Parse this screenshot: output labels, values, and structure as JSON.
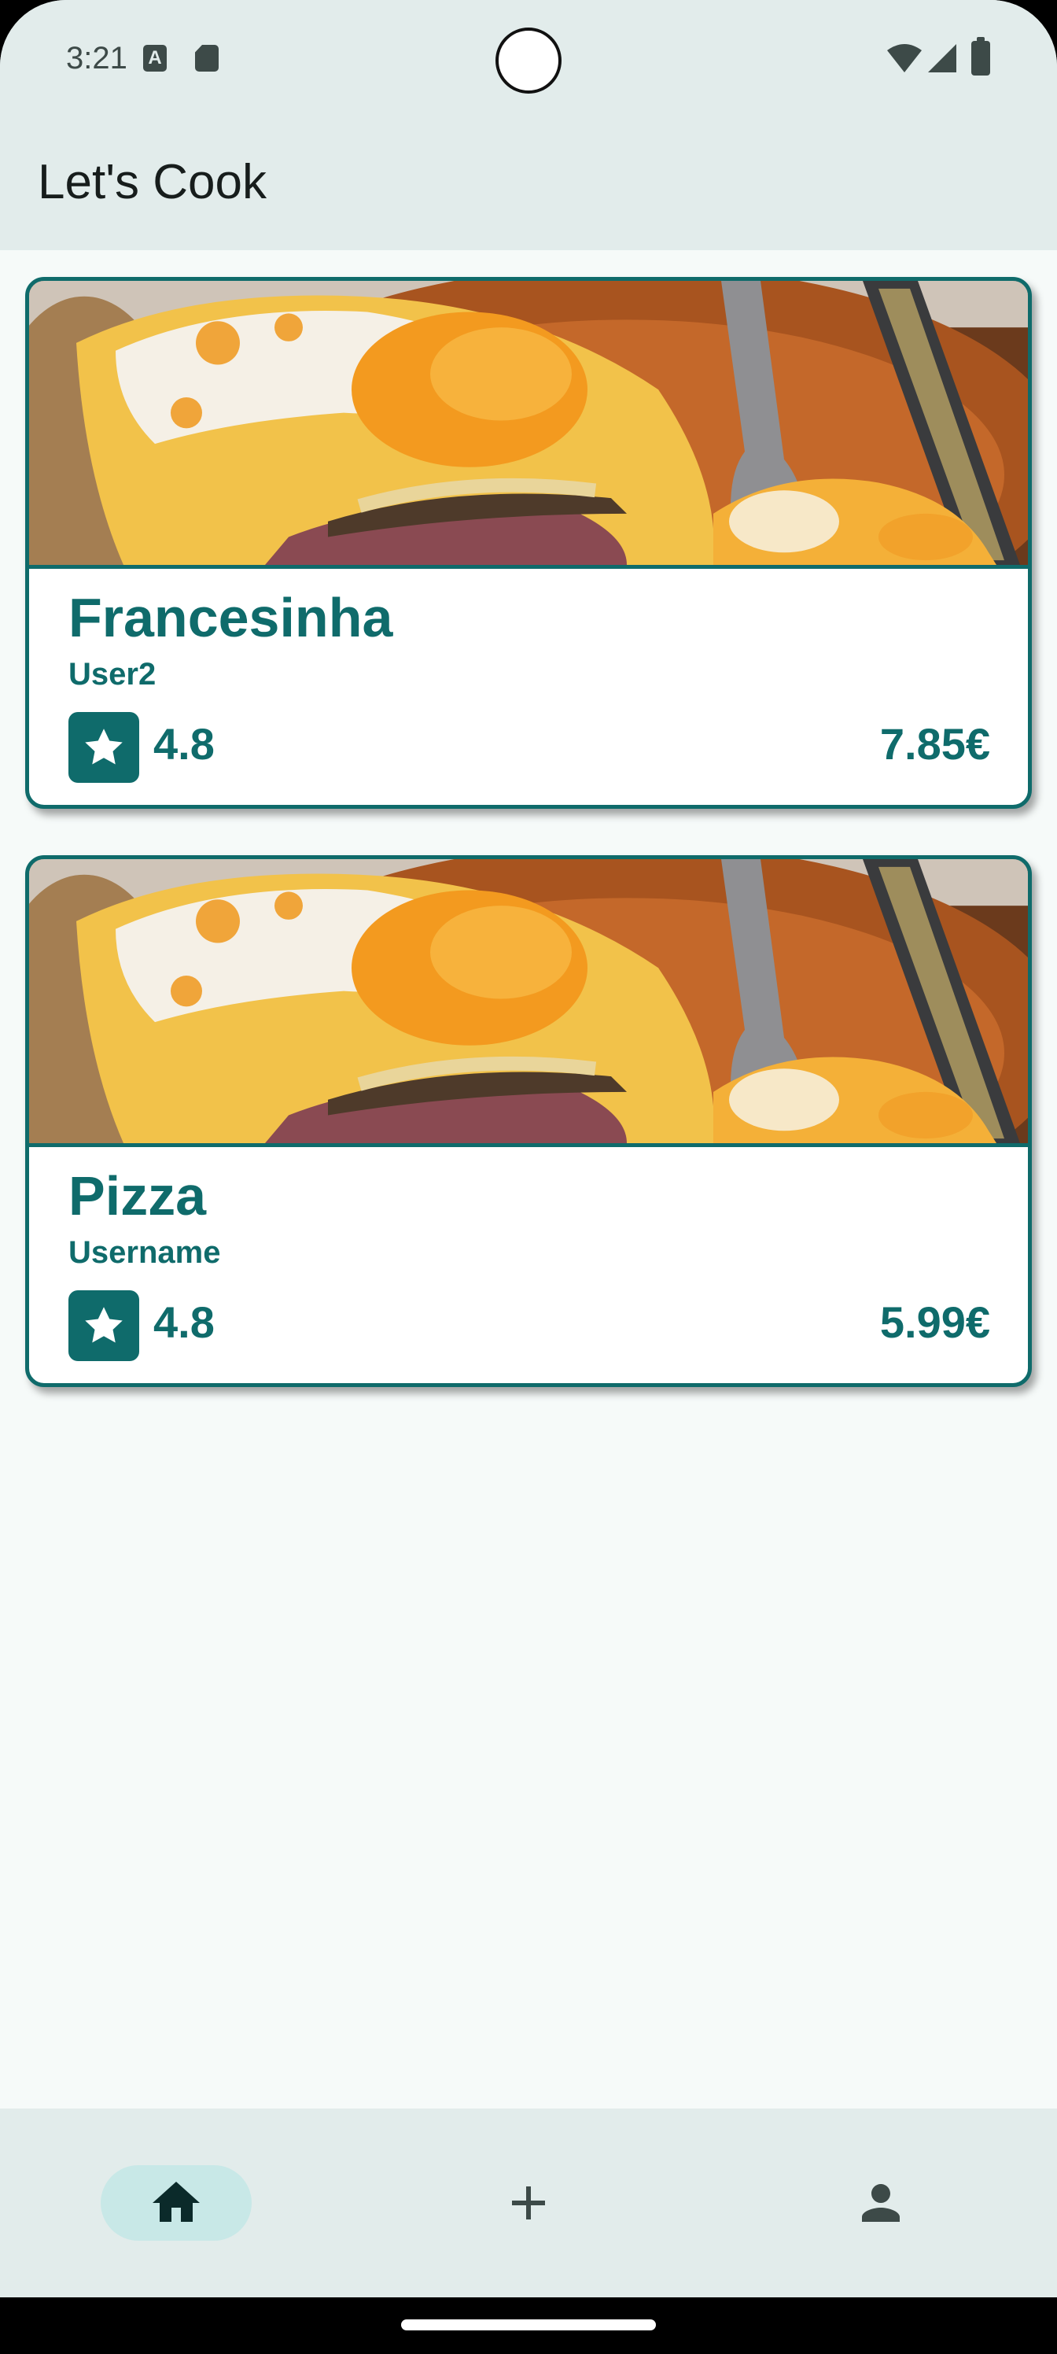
{
  "status_bar": {
    "time": "3:21",
    "icons": [
      "text-a-icon",
      "sd-card-icon",
      "wifi-icon",
      "signal-icon",
      "battery-icon"
    ],
    "a_glyph": "A"
  },
  "app_bar": {
    "title": "Let's Cook"
  },
  "recipes": [
    {
      "title": "Francesinha",
      "user": "User2",
      "rating": "4.8",
      "price": "7.85€"
    },
    {
      "title": "Pizza",
      "user": "Username",
      "rating": "4.8",
      "price": "5.99€"
    }
  ],
  "nav": {
    "items": [
      {
        "name": "home",
        "icon": "home-icon",
        "active": true
      },
      {
        "name": "add",
        "icon": "plus-icon",
        "active": false
      },
      {
        "name": "profile",
        "icon": "person-icon",
        "active": false
      }
    ]
  },
  "colors": {
    "primary": "#0f6b6b",
    "surface": "#e2eceb",
    "background": "#f6faf9",
    "nav_active": "#c8e8e7"
  }
}
